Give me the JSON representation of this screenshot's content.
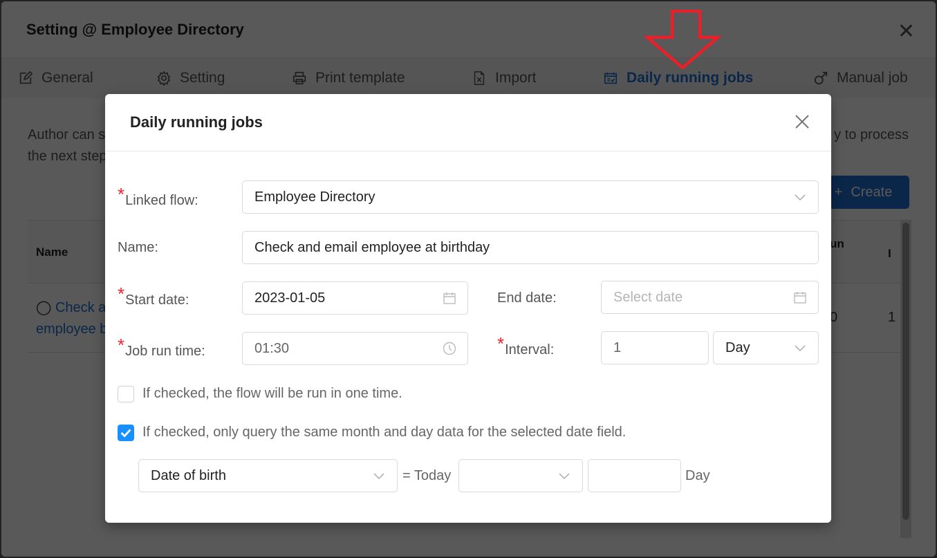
{
  "background": {
    "window_title": "Setting @ Employee Directory",
    "tabs": [
      {
        "label": "General",
        "icon": "edit-icon"
      },
      {
        "label": "Setting",
        "icon": "gear-icon"
      },
      {
        "label": "Print template",
        "icon": "printer-icon"
      },
      {
        "label": "Import",
        "icon": "excel-file-icon"
      },
      {
        "label": "Daily running jobs",
        "icon": "calendar-check-icon",
        "active": true
      },
      {
        "label": "Manual job",
        "icon": "male-icon"
      }
    ],
    "description_left_line1": "Author can s",
    "description_left_line2": "the next step",
    "description_right": "y to process",
    "create_button": "Create",
    "table": {
      "headers": {
        "name": "Name",
        "run": "un",
        "interval": "I"
      },
      "row": {
        "name_line1": "Check a",
        "name_line2": "employee b",
        "run_value": "0",
        "interval_value": "1"
      }
    }
  },
  "modal": {
    "title": "Daily running jobs",
    "linked_flow": {
      "label": "Linked flow:",
      "value": "Employee Directory",
      "required": true
    },
    "name": {
      "label": "Name:",
      "value": "Check and email employee at birthday"
    },
    "start_date": {
      "label": "Start date:",
      "value": "2023-01-05",
      "required": true
    },
    "end_date": {
      "label": "End date:",
      "placeholder": "Select date"
    },
    "job_run_time": {
      "label": "Job run time:",
      "value": "01:30",
      "required": true
    },
    "interval": {
      "label": "Interval:",
      "value": "1",
      "unit": "Day",
      "required": true
    },
    "one_time": {
      "label": "If checked, the flow will be run in one time.",
      "checked": false
    },
    "same_month_day": {
      "label": "If checked, only query the same month and day data for the selected date field.",
      "checked": true
    },
    "date_condition": {
      "field": "Date of birth",
      "equals_label": "= Today",
      "operator": "",
      "offset": "",
      "unit_label": "Day"
    }
  },
  "colors": {
    "primary": "#1890ff",
    "required": "#f5222d",
    "annotation": "#e8202a"
  }
}
